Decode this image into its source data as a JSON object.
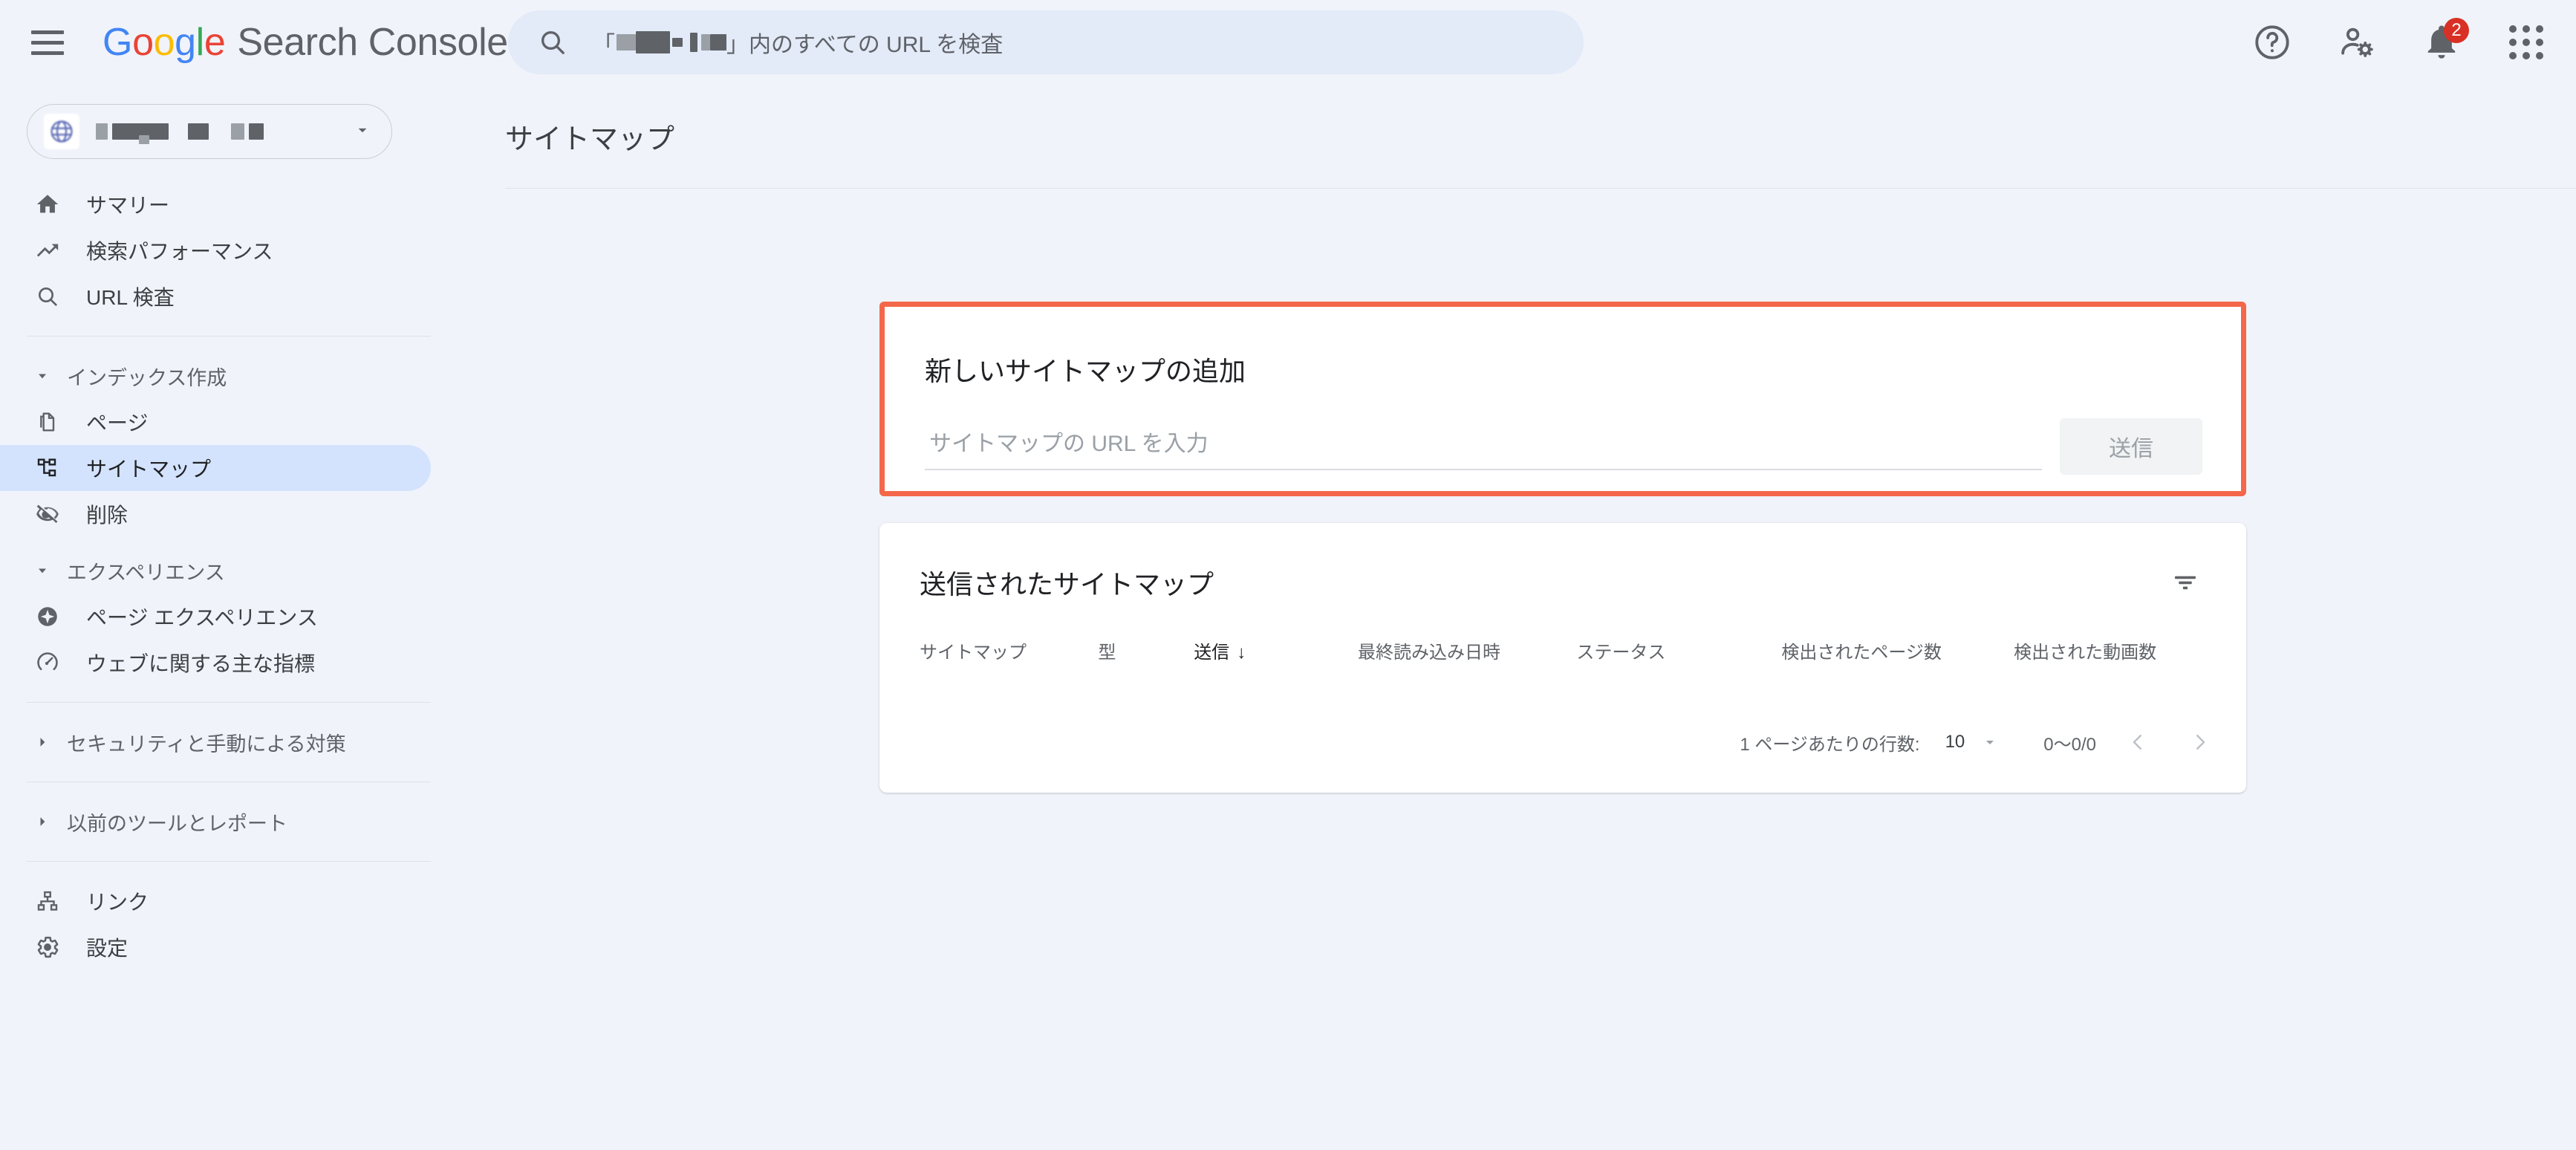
{
  "header": {
    "menu_icon": "hamburger-menu-icon",
    "brand_google": "Google",
    "brand_product": "Search Console",
    "search": {
      "icon": "search-icon",
      "placeholder_prefix": "「",
      "placeholder_suffix": "」内のすべての URL を検査",
      "redacted": true
    },
    "icons": {
      "help": "help-circle-icon",
      "account_settings": "person-gear-icon",
      "notifications": "bell-icon",
      "apps": "apps-grid-icon"
    },
    "notification_count": "2"
  },
  "property_selector": {
    "icon": "globe-icon",
    "name_redacted": true,
    "caret": "chevron-down-icon"
  },
  "sidebar": {
    "items": [
      {
        "label": "サマリー",
        "icon": "home-icon",
        "selected": false
      },
      {
        "label": "検索パフォーマンス",
        "icon": "trending-up-icon",
        "selected": false
      },
      {
        "label": "URL 検査",
        "icon": "search-icon",
        "selected": false
      }
    ],
    "sections": [
      {
        "label": "インデックス作成",
        "expanded": true,
        "items": [
          {
            "label": "ページ",
            "icon": "pages-copy-icon",
            "selected": false
          },
          {
            "label": "サイトマップ",
            "icon": "sitemap-icon",
            "selected": true
          },
          {
            "label": "削除",
            "icon": "eye-off-icon",
            "selected": false
          }
        ]
      },
      {
        "label": "エクスペリエンス",
        "expanded": true,
        "items": [
          {
            "label": "ページ エクスペリエンス",
            "icon": "sparkle-circle-icon",
            "selected": false
          },
          {
            "label": "ウェブに関する主な指標",
            "icon": "speedometer-icon",
            "selected": false
          }
        ]
      },
      {
        "label": "セキュリティと手動による対策",
        "expanded": false,
        "items": []
      },
      {
        "label": "以前のツールとレポート",
        "expanded": false,
        "items": []
      }
    ],
    "footer_items": [
      {
        "label": "リンク",
        "icon": "link-hierarchy-icon",
        "selected": false
      },
      {
        "label": "設定",
        "icon": "gear-icon",
        "selected": false
      }
    ]
  },
  "main": {
    "page_title": "サイトマップ",
    "add_sitemap": {
      "title": "新しいサイトマップの追加",
      "input_placeholder": "サイトマップの URL を入力",
      "input_value": "",
      "submit_label": "送信",
      "submit_disabled": true,
      "highlight_color": "#f4674a"
    },
    "submitted_sitemaps": {
      "title": "送信されたサイトマップ",
      "filter_icon": "filter-list-icon",
      "columns": [
        {
          "label": "サイトマップ",
          "sorted": false
        },
        {
          "label": "型",
          "sorted": false
        },
        {
          "label": "送信",
          "sorted": true,
          "sort_arrow": "↓"
        },
        {
          "label": "最終読み込み日時",
          "sorted": false
        },
        {
          "label": "ステータス",
          "sorted": false
        },
        {
          "label": "検出されたページ数",
          "sorted": false
        },
        {
          "label": "検出された動画数",
          "sorted": false
        }
      ],
      "rows": [],
      "pagination": {
        "rows_per_page_label": "1 ページあたりの行数:",
        "rows_per_page_value": "10",
        "caret": "chevron-down-icon",
        "range": "0〜0/0",
        "prev_icon": "chevron-left-icon",
        "next_icon": "chevron-right-icon",
        "prev_enabled": false,
        "next_enabled": false
      }
    }
  },
  "colors": {
    "background": "#f0f3fa",
    "card": "#ffffff",
    "selected_nav": "#d3e3fd",
    "accent_highlight": "#f4674a",
    "badge_red": "#d93025",
    "text_primary": "#202124",
    "text_secondary": "#5f6368"
  }
}
